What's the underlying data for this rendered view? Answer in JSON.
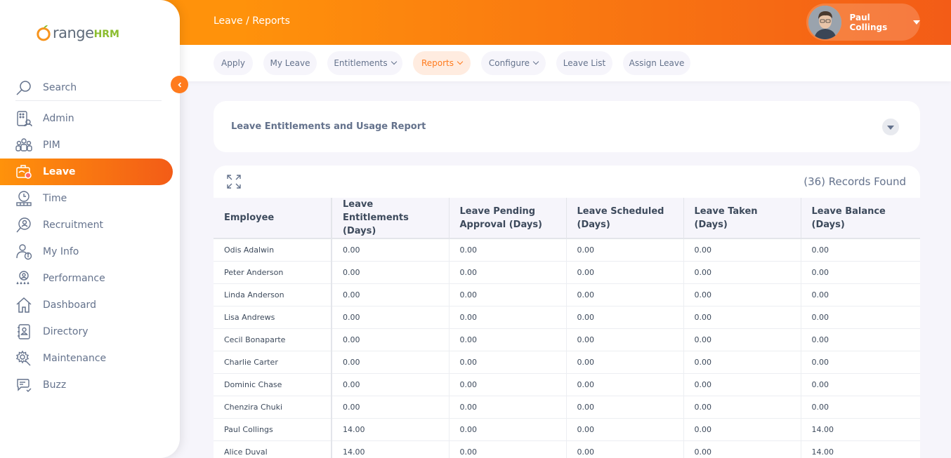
{
  "app": {
    "logo_main": "range",
    "logo_suffix": "HRM",
    "brand_color": "#ff7b1d"
  },
  "header": {
    "breadcrumb": "Leave / Reports",
    "user_name": "Paul Collings"
  },
  "sidebar": {
    "search_label": "Search",
    "items": [
      {
        "label": "Admin",
        "icon": "admin-icon"
      },
      {
        "label": "PIM",
        "icon": "pim-icon"
      },
      {
        "label": "Leave",
        "icon": "leave-icon",
        "active": true
      },
      {
        "label": "Time",
        "icon": "time-icon"
      },
      {
        "label": "Recruitment",
        "icon": "recruitment-icon"
      },
      {
        "label": "My Info",
        "icon": "my-info-icon"
      },
      {
        "label": "Performance",
        "icon": "performance-icon"
      },
      {
        "label": "Dashboard",
        "icon": "dashboard-icon"
      },
      {
        "label": "Directory",
        "icon": "directory-icon"
      },
      {
        "label": "Maintenance",
        "icon": "maintenance-icon"
      },
      {
        "label": "Buzz",
        "icon": "buzz-icon"
      }
    ]
  },
  "tabs": [
    {
      "label": "Apply"
    },
    {
      "label": "My Leave"
    },
    {
      "label": "Entitlements",
      "dropdown": true
    },
    {
      "label": "Reports",
      "dropdown": true,
      "active": true
    },
    {
      "label": "Configure",
      "dropdown": true
    },
    {
      "label": "Leave List"
    },
    {
      "label": "Assign Leave"
    }
  ],
  "report": {
    "title": "Leave Entitlements and Usage Report",
    "records_found": "(36) Records Found",
    "columns": [
      [
        "Employee"
      ],
      [
        "Leave Entitlements",
        "(Days)"
      ],
      [
        "Leave Pending",
        "Approval (Days)"
      ],
      [
        "Leave Scheduled",
        "(Days)"
      ],
      [
        "Leave Taken (Days)"
      ],
      [
        "Leave Balance",
        "(Days)"
      ]
    ],
    "rows": [
      [
        "Odis Adalwin",
        "0.00",
        "0.00",
        "0.00",
        "0.00",
        "0.00"
      ],
      [
        "Peter Anderson",
        "0.00",
        "0.00",
        "0.00",
        "0.00",
        "0.00"
      ],
      [
        "Linda Anderson",
        "0.00",
        "0.00",
        "0.00",
        "0.00",
        "0.00"
      ],
      [
        "Lisa Andrews",
        "0.00",
        "0.00",
        "0.00",
        "0.00",
        "0.00"
      ],
      [
        "Cecil Bonaparte",
        "0.00",
        "0.00",
        "0.00",
        "0.00",
        "0.00"
      ],
      [
        "Charlie Carter",
        "0.00",
        "0.00",
        "0.00",
        "0.00",
        "0.00"
      ],
      [
        "Dominic Chase",
        "0.00",
        "0.00",
        "0.00",
        "0.00",
        "0.00"
      ],
      [
        "Chenzira Chuki",
        "0.00",
        "0.00",
        "0.00",
        "0.00",
        "0.00"
      ],
      [
        "Paul Collings",
        "14.00",
        "0.00",
        "0.00",
        "0.00",
        "14.00"
      ],
      [
        "Alice Duval",
        "14.00",
        "0.00",
        "0.00",
        "0.00",
        "14.00"
      ]
    ]
  }
}
